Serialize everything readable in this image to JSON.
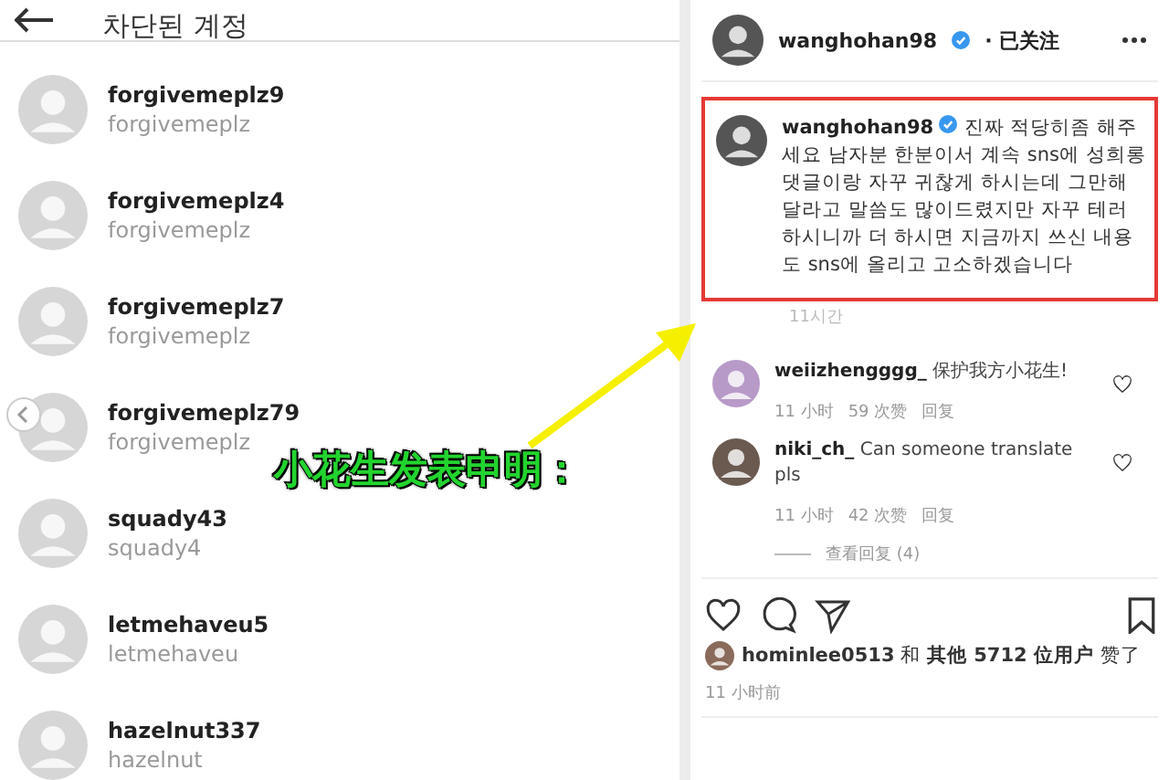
{
  "blocked_accounts": {
    "title": "차단된 계정",
    "accounts": [
      {
        "username": "forgivemeplz9",
        "name": "forgivemeplz"
      },
      {
        "username": "forgivemeplz4",
        "name": "forgivemeplz"
      },
      {
        "username": "forgivemeplz7",
        "name": "forgivemeplz"
      },
      {
        "username": "forgivemeplz79",
        "name": "forgivemeplz"
      },
      {
        "username": "squady43",
        "name": "squady4"
      },
      {
        "username": "letmehaveu5",
        "name": "letmehaveu"
      },
      {
        "username": "hazelnut337",
        "name": "hazelnut"
      }
    ]
  },
  "post": {
    "author": "wanghohan98",
    "follow_status": "· 已关注",
    "caption": {
      "author": "wanghohan98",
      "text": "진짜 적당히좀 해주세요 남자분 한분이서 계속 sns에 성희롱 댓글이랑 자꾸 귀찮게 하시는데 그만해달라고 말씀도 많이드렸지만 자꾸 테러하시니까 더 하시면 지금까지 쓰신 내용도 sns에 올리고 고소하겠습니다",
      "time": "11시간"
    },
    "comments": [
      {
        "author": "weiizhengggg_",
        "text": "保护我方小花生!",
        "time": "11 小时",
        "likes": "59 次赞",
        "reply": "回复"
      },
      {
        "author": "niki_ch_",
        "text": "Can someone translate pls",
        "time": "11 小时",
        "likes": "42 次赞",
        "reply": "回复",
        "view_replies": "查看回复 (4)"
      }
    ],
    "liked_by": "**hominlee0513** 和 **其他 5712 位用户** 赞了",
    "posted": "11 小时前"
  },
  "annotation": {
    "caption": "小花生发表申明："
  }
}
